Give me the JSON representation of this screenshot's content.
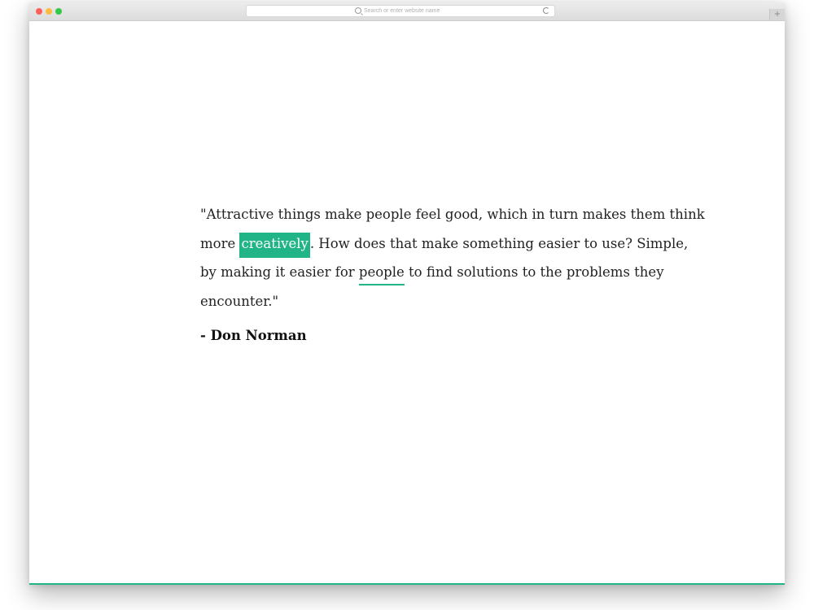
{
  "browser": {
    "address_placeholder": "Search or enter website name",
    "new_tab_label": "+"
  },
  "quote": {
    "part1": "\"Attractive things make people feel good, which in turn makes them think more ",
    "highlight": "creatively",
    "part2": ". How does that make something easier to use? Simple, by making it easier for ",
    "underlined": "people",
    "part3": " to find solutions to the problems they encounter.\"",
    "author": "- Don Norman"
  },
  "colors": {
    "accent": "#20b486",
    "text": "#222222"
  }
}
